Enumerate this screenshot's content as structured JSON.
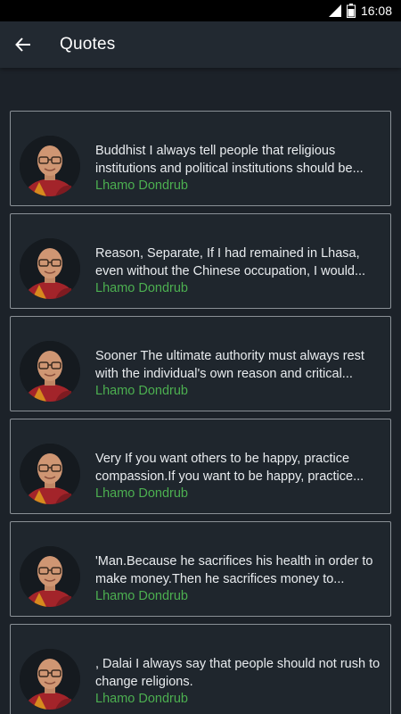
{
  "status_bar": {
    "time": "16:08"
  },
  "app_bar": {
    "title": "Quotes"
  },
  "quotes": [
    {
      "line1": " Buddhist I always tell people that religious",
      "line2": "institutions and political institutions should be...",
      "author": "Lhamo Dondrub"
    },
    {
      "line1": " Reason, Separate,  If I had remained in Lhasa,",
      "line2": "even without the Chinese occupation, I would...",
      "author": "Lhamo Dondrub"
    },
    {
      "line1": " Sooner The ultimate authority must always rest",
      "line2": "with the individual's own reason and critical...",
      "author": "Lhamo Dondrub"
    },
    {
      "line1": " Very If you want others to be happy, practice",
      "line2": "compassion.If you want to be happy, practice...",
      "author": "Lhamo Dondrub"
    },
    {
      "line1": "'Man.Because he sacrifices his health in order to",
      "line2": "make money.Then he sacrifices money to...",
      "author": "Lhamo Dondrub"
    },
    {
      "line1": ", Dalai I always say that people should not rush to",
      "line2": "change religions.",
      "author": "Lhamo Dondrub"
    }
  ],
  "colors": {
    "background": "#1c2229",
    "app_bar": "#222931",
    "author": "#4caf50",
    "card_border": "#8a9096"
  },
  "icons": {
    "back": "arrow-left-icon",
    "avatar": "avatar-portrait-image"
  }
}
